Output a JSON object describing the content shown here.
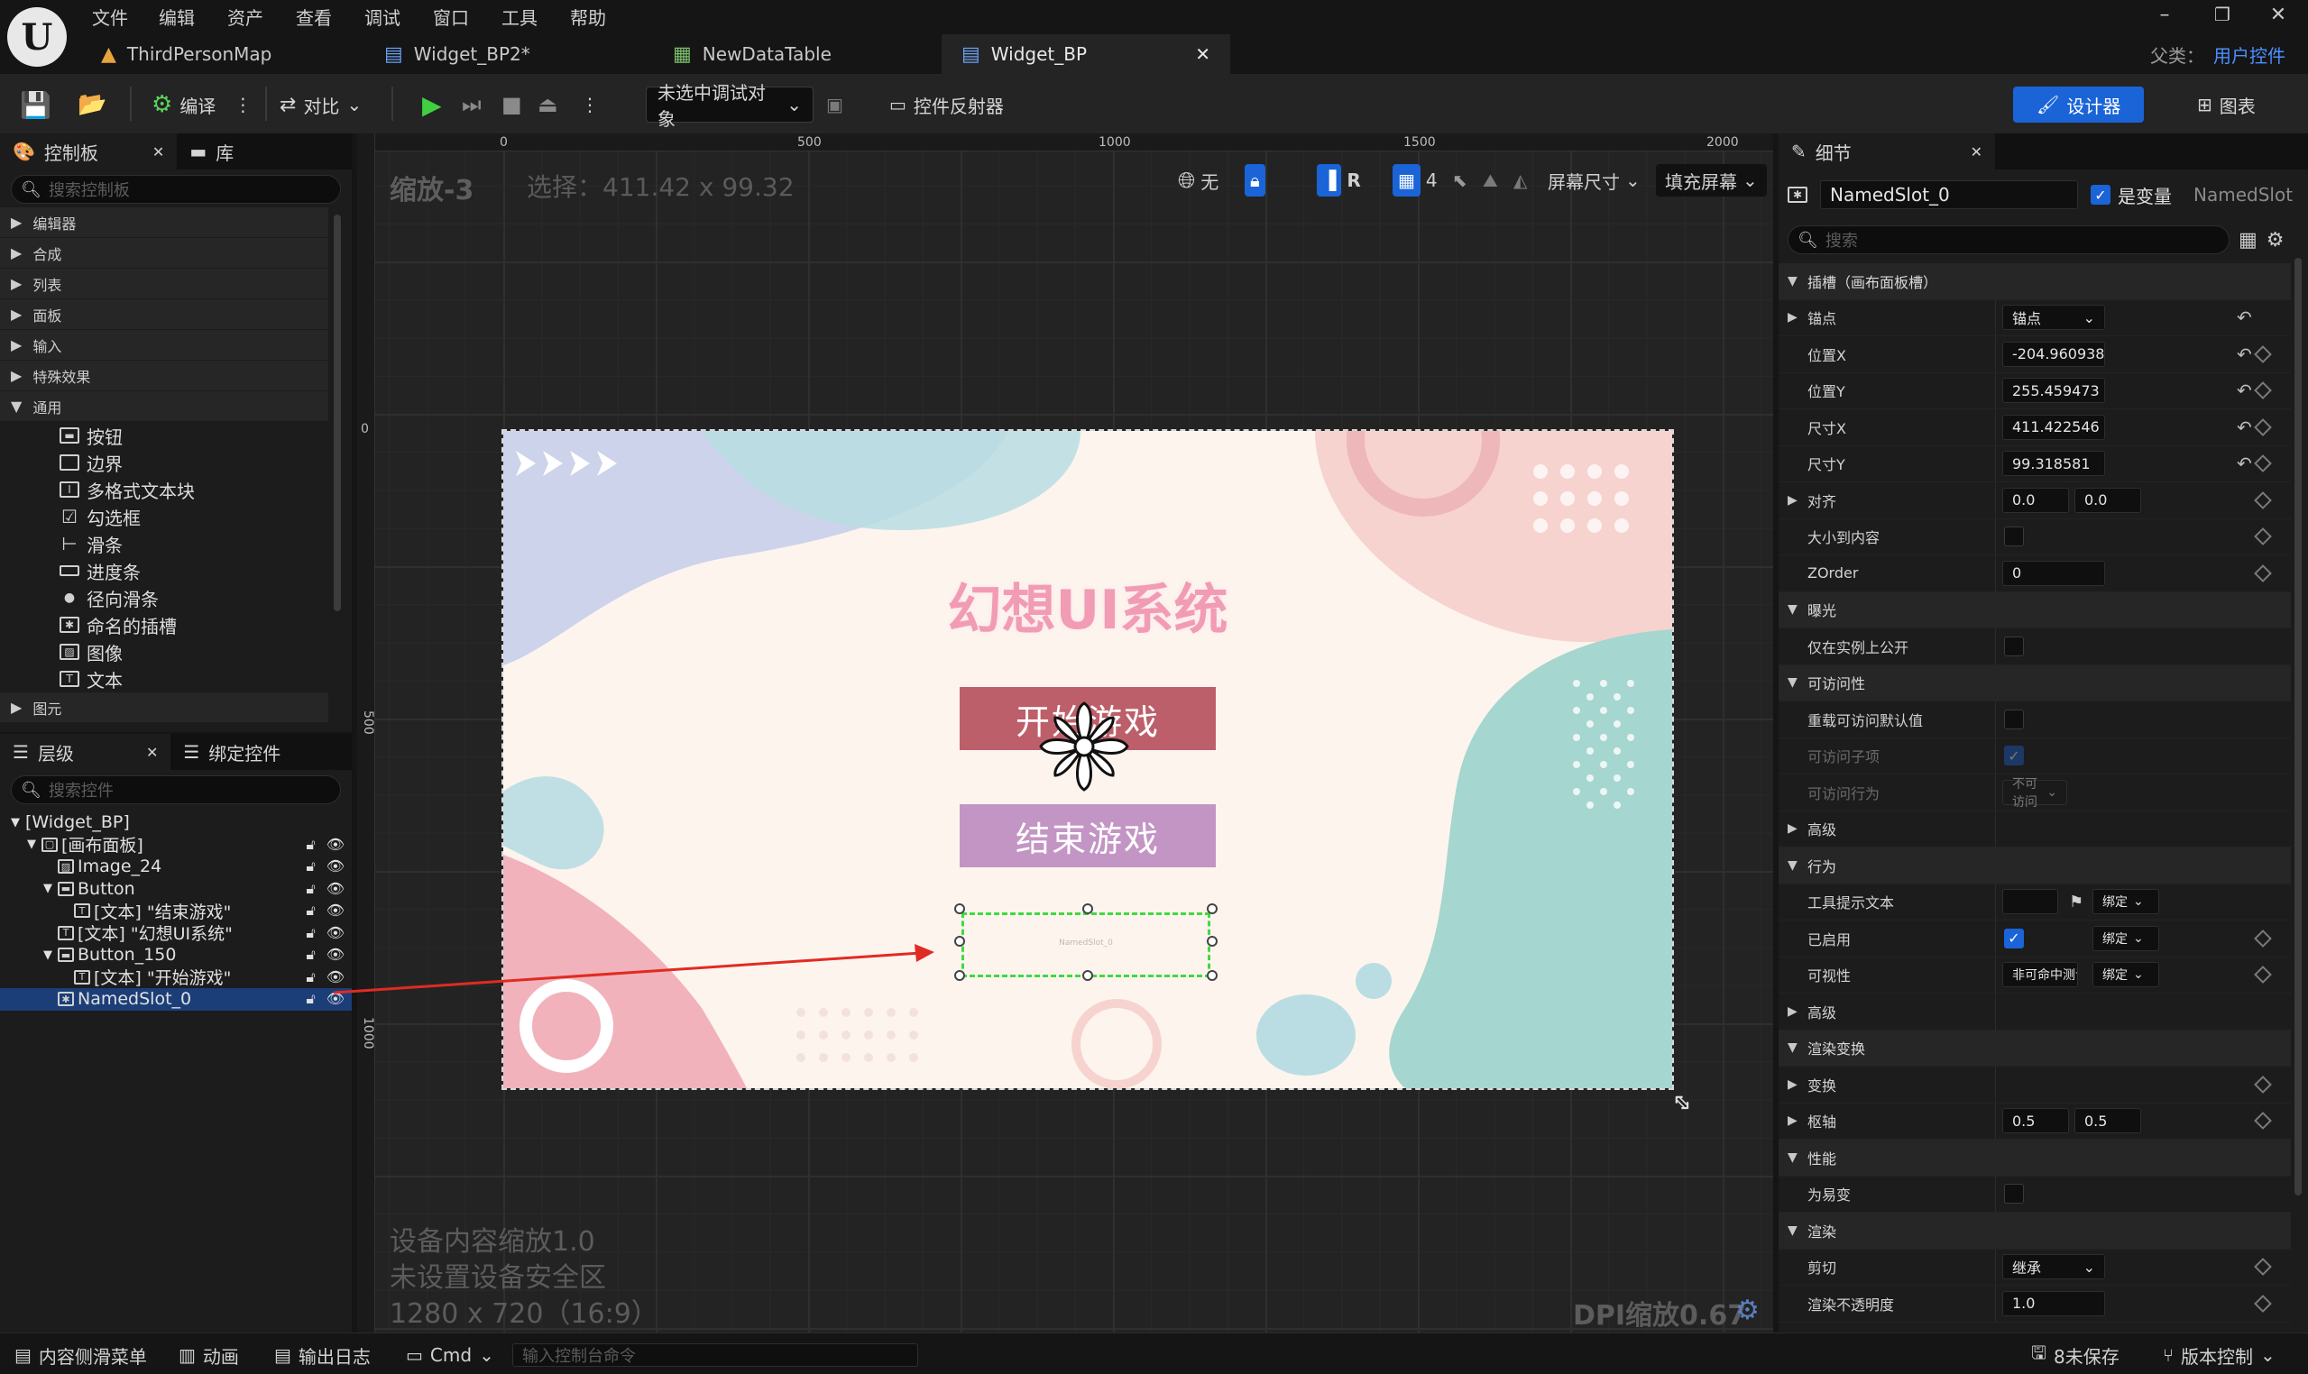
{
  "titlebar": {
    "menu": [
      "文件",
      "编辑",
      "资产",
      "查看",
      "调试",
      "窗口",
      "工具",
      "帮助"
    ],
    "tabs": [
      {
        "label": "ThirdPersonMap",
        "active": false
      },
      {
        "label": "Widget_BP2*",
        "active": false
      },
      {
        "label": "NewDataTable",
        "active": false
      },
      {
        "label": "Widget_BP",
        "active": true
      }
    ],
    "parent_label": "父类：",
    "parent_value": "用户控件"
  },
  "toolbar": {
    "compile": "编译",
    "diff": "对比",
    "debug_target": "未选中调试对象",
    "reflector": "控件反射器",
    "designer": "设计器",
    "graph": "图表"
  },
  "palette": {
    "tab_palette": "控制板",
    "tab_library": "库",
    "search_placeholder": "搜索控制板",
    "categories": [
      "编辑器",
      "合成",
      "列表",
      "面板",
      "输入",
      "特殊效果",
      "通用"
    ],
    "common_items": [
      {
        "icon": "button-icon",
        "label": "按钮"
      },
      {
        "icon": "border-icon",
        "label": "边界"
      },
      {
        "icon": "rich-text-icon",
        "label": "多格式文本块"
      },
      {
        "icon": "checkbox-icon",
        "label": "勾选框"
      },
      {
        "icon": "slider-icon",
        "label": "滑条"
      },
      {
        "icon": "progress-bar-icon",
        "label": "进度条"
      },
      {
        "icon": "radial-slider-icon",
        "label": "径向滑条"
      },
      {
        "icon": "named-slot-icon",
        "label": "命名的插槽"
      },
      {
        "icon": "image-icon",
        "label": "图像"
      },
      {
        "icon": "text-icon",
        "label": "文本"
      }
    ],
    "last_category": "图元"
  },
  "hierarchy": {
    "tab_hierarchy": "层级",
    "tab_bind": "绑定控件",
    "search_placeholder": "搜索控件",
    "rows": [
      {
        "label": "[Widget_BP]",
        "indent": 0,
        "arrow": "▼",
        "icon": ""
      },
      {
        "label": "[画布面板]",
        "indent": 1,
        "arrow": "▼",
        "icon": "canvas"
      },
      {
        "label": "Image_24",
        "indent": 2,
        "arrow": "",
        "icon": "image"
      },
      {
        "label": "Button",
        "indent": 2,
        "arrow": "▼",
        "icon": "button"
      },
      {
        "label": "[文本] \"结束游戏\"",
        "indent": 3,
        "arrow": "",
        "icon": "text"
      },
      {
        "label": "[文本] \"幻想UI系统\"",
        "indent": 2,
        "arrow": "",
        "icon": "text"
      },
      {
        "label": "Button_150",
        "indent": 2,
        "arrow": "▼",
        "icon": "button"
      },
      {
        "label": "[文本] \"开始游戏\"",
        "indent": 3,
        "arrow": "",
        "icon": "text"
      },
      {
        "label": "NamedSlot_0",
        "indent": 2,
        "arrow": "",
        "icon": "slot",
        "selected": true
      }
    ]
  },
  "viewport": {
    "zoom": "缩放-3",
    "selection": "选择：411.42 x 99.32",
    "ruler_top": [
      "0",
      "500",
      "1000",
      "1500",
      "2000"
    ],
    "ruler_left": [
      "0",
      "500",
      "1000"
    ],
    "none_label": "无",
    "r_label": "R",
    "grid_value": "4",
    "screen_size": "屏幕尺寸",
    "fill_screen": "填充屏幕",
    "device_scale": "设备内容缩放1.0",
    "safe_zone": "未设置设备安全区",
    "resolution": "1280 x 720（16:9）",
    "dpi": "DPI缩放0.67"
  },
  "design": {
    "title": "幻想UI系统",
    "start_button": "开始游戏",
    "end_button": "结束游戏",
    "slot_label": "NamedSlot_0",
    "colors": {
      "start": "#bd5f6a",
      "end": "#c395c4",
      "title": "#f19cb4",
      "selection": "#3ddc3d",
      "arrow": "#e02b22"
    }
  },
  "details": {
    "tab": "细节",
    "name": "NamedSlot_0",
    "is_variable": "是变量",
    "class_name": "NamedSlot",
    "search_placeholder": "搜索",
    "rows": [
      {
        "type": "section",
        "label": "插槽（画布面板槽）"
      },
      {
        "type": "combo",
        "label": "锚点",
        "value": "锚点",
        "arrow": "▶",
        "reset": true
      },
      {
        "type": "field",
        "label": "位置X",
        "value": "-204.960938",
        "reset": true,
        "diamond": true
      },
      {
        "type": "field",
        "label": "位置Y",
        "value": "255.459473",
        "reset": true,
        "diamond": true
      },
      {
        "type": "field",
        "label": "尺寸X",
        "value": "411.422546",
        "reset": true,
        "diamond": true
      },
      {
        "type": "field",
        "label": "尺寸Y",
        "value": "99.318581",
        "reset": true,
        "diamond": true
      },
      {
        "type": "pair",
        "label": "对齐",
        "value": "0.0",
        "value2": "0.0",
        "arrow": "▶",
        "diamond": true
      },
      {
        "type": "check",
        "label": "大小到内容",
        "checked": false,
        "diamond": true
      },
      {
        "type": "field",
        "label": "ZOrder",
        "value": "0",
        "diamond": true
      },
      {
        "type": "section",
        "label": "曝光"
      },
      {
        "type": "check",
        "label": "仅在实例上公开",
        "checked": false
      },
      {
        "type": "section",
        "label": "可访问性"
      },
      {
        "type": "check",
        "label": "重载可访问默认值",
        "checked": false
      },
      {
        "type": "check",
        "label": "可访问子项",
        "checked": true,
        "dim": true
      },
      {
        "type": "combo-small",
        "label": "可访问行为",
        "value": "不可访问",
        "dim": true
      },
      {
        "type": "subsection",
        "label": "高级",
        "arrow": "▶"
      },
      {
        "type": "section",
        "label": "行为"
      },
      {
        "type": "tooltip",
        "label": "工具提示文本",
        "bind": "绑定"
      },
      {
        "type": "check-bind",
        "label": "已启用",
        "checked": true,
        "bind": "绑定",
        "diamond": true
      },
      {
        "type": "combo-bind",
        "label": "可视性",
        "value": "非可命中测试",
        "bind": "绑定",
        "diamond": true
      },
      {
        "type": "subsection",
        "label": "高级",
        "arrow": "▶"
      },
      {
        "type": "section",
        "label": "渲染变换"
      },
      {
        "type": "subsection",
        "label": "变换",
        "arrow": "▶",
        "diamond": true
      },
      {
        "type": "pair",
        "label": "枢轴",
        "value": "0.5",
        "value2": "0.5",
        "arrow": "▶",
        "diamond": true
      },
      {
        "type": "section",
        "label": "性能"
      },
      {
        "type": "check",
        "label": "为易变",
        "checked": false
      },
      {
        "type": "section",
        "label": "渲染"
      },
      {
        "type": "combo",
        "label": "剪切",
        "value": "继承",
        "diamond": true
      },
      {
        "type": "field",
        "label": "渲染不透明度",
        "value": "1.0",
        "diamond": true
      }
    ]
  },
  "statusbar": {
    "content_drawer": "内容侧滑菜单",
    "animation": "动画",
    "output_log": "输出日志",
    "cmd": "Cmd",
    "cmd_placeholder": "输入控制台命令",
    "unsaved": "8未保存",
    "source_control": "版本控制"
  }
}
